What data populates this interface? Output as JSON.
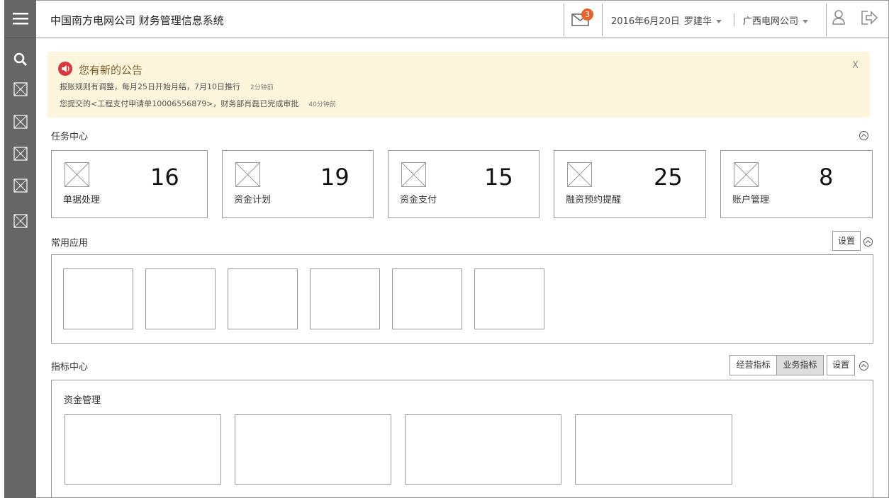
{
  "app": {
    "title": "中国南方电网公司 财务管理信息系统"
  },
  "header": {
    "mail_count": "3",
    "date": "2016年6月20日",
    "user": "罗建华",
    "company": "广西电网公司"
  },
  "icons": {
    "menu": "menu-icon",
    "search": "search-icon",
    "placeholder": "image-placeholder-icon",
    "mail": "mail-icon",
    "user": "user-icon",
    "logout": "logout-icon",
    "announce": "speaker-icon"
  },
  "notice": {
    "title": "您有新的公告",
    "lines": [
      {
        "text": "报账规则有调整，每月25日开始月结，7月10日推行",
        "time": "2分钟前"
      },
      {
        "text": "您提交的<工程支付申请单10006556879>，财务部肖磊已完成审批",
        "time": "40分钟前"
      }
    ],
    "close": "X"
  },
  "tasks": {
    "title": "任务中心",
    "items": [
      {
        "label": "单据处理",
        "count": "16"
      },
      {
        "label": "资金计划",
        "count": "19"
      },
      {
        "label": "资金支付",
        "count": "15"
      },
      {
        "label": "融资预约提醒",
        "count": "25"
      },
      {
        "label": "账户管理",
        "count": "8"
      }
    ]
  },
  "apps": {
    "title": "常用应用",
    "settings": "设置"
  },
  "metrics": {
    "title": "指标中心",
    "tab_operation": "经营指标",
    "tab_business": "业务指标",
    "settings": "设置",
    "panel_title": "资金管理"
  },
  "colors": {
    "sidebar": "#666666",
    "notice_bg": "#fdf6dc",
    "badge": "#e8622a",
    "announce_icon": "#d9363e"
  }
}
